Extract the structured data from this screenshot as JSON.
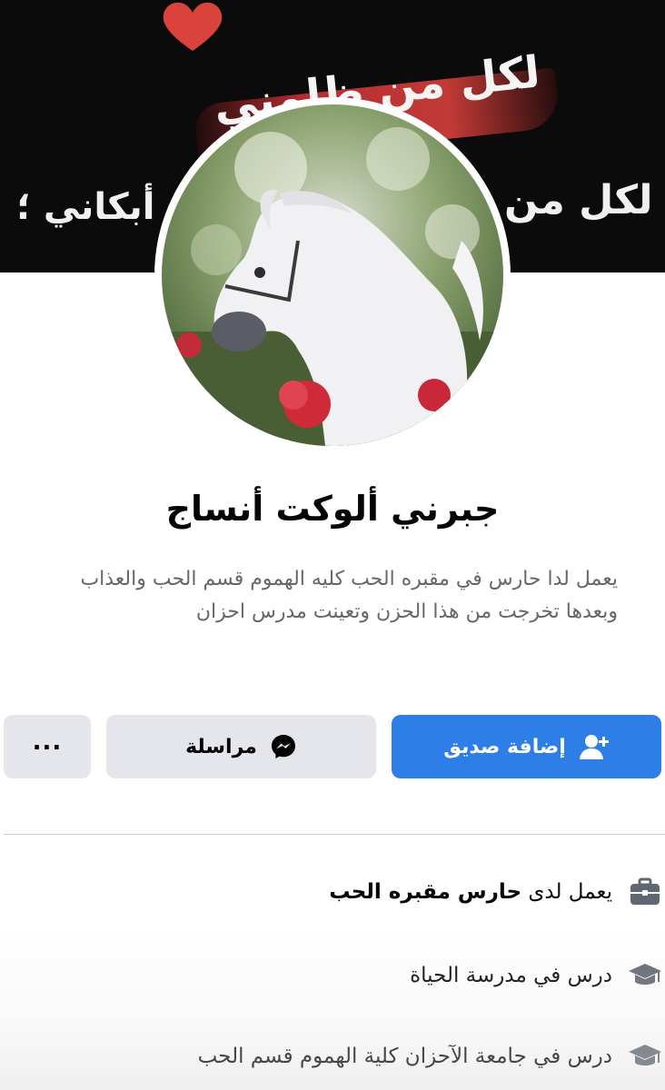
{
  "cover": {
    "line1": "لكل من ظلمني",
    "line2_right": "لكل من",
    "line2_left": "أبكاني ؛"
  },
  "profile": {
    "name": "جبرني ألوكت أنساج",
    "bio": "يعمل لدا حارس في مقبره الحب كليه الهموم قسم الحب والعذاب وبعدها تخرجت من هذا الحزن وتعينت مدرس احزان"
  },
  "actions": {
    "add_friend": "إضافة صديق",
    "message": "مراسلة",
    "more": "..."
  },
  "colors": {
    "primary": "#2d7ee6",
    "secondary_button": "#e4e6eb",
    "muted_text": "#65676b"
  },
  "details": [
    {
      "prefix": "يعمل لدى",
      "strong": "حارس مقبره الحب",
      "icon": "briefcase-icon"
    },
    {
      "prefix": "درس في مدرسة الحياة",
      "strong": "",
      "icon": "graduation-cap-icon"
    },
    {
      "prefix": "درس في جامعة الآحزان كلية الهموم قسم الحب",
      "strong": "",
      "icon": "graduation-cap-icon"
    }
  ]
}
